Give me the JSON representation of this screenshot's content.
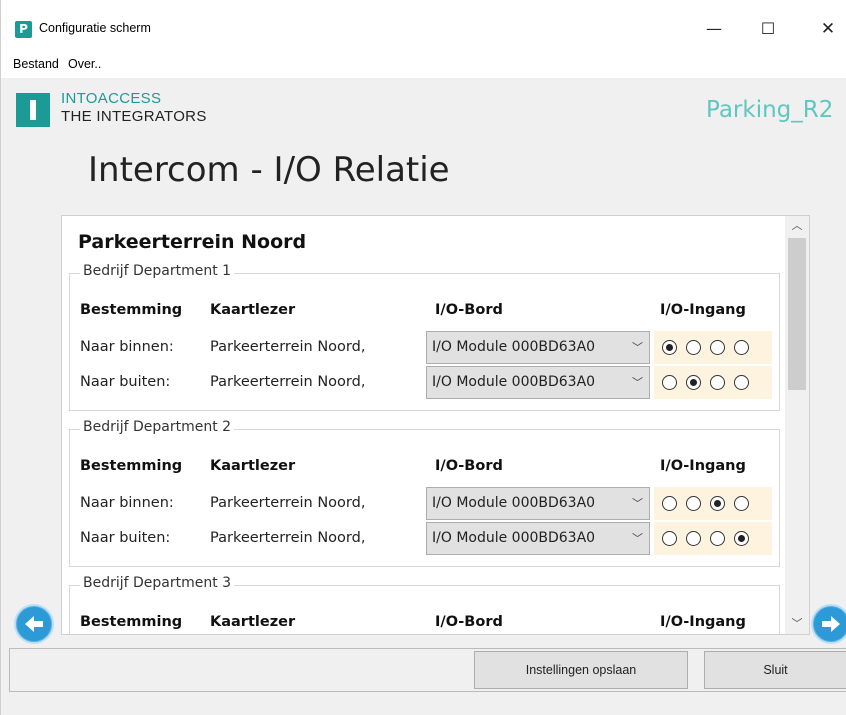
{
  "window": {
    "title": "Configuratie scherm",
    "app_icon_letter": "P",
    "controls": {
      "minimize": "—",
      "maximize": "☐",
      "close": "✕"
    }
  },
  "menu": {
    "items": [
      "Bestand",
      "Over.."
    ]
  },
  "header": {
    "brand_line1": "INTOACCESS",
    "brand_line2": "THE INTEGRATORS",
    "profile": "Parking_R2",
    "brand_color": "#1c9a95"
  },
  "page_title": "Intercom - I/O Relatie",
  "lot": {
    "name": "Parkeerterrein Noord",
    "column_headers": {
      "destination": "Bestemming",
      "reader": "Kaartlezer",
      "io_board": "I/O-Bord",
      "io_input": "I/O-Ingang"
    },
    "departments": [
      {
        "name": "Bedrijf Department 1",
        "rows": [
          {
            "destination": "Naar binnen:",
            "reader": "Parkeerterrein Noord,",
            "io_board": "I/O Module 000BD63A0",
            "selected_input": 0
          },
          {
            "destination": "Naar buiten:",
            "reader": "Parkeerterrein Noord,",
            "io_board": "I/O Module 000BD63A0",
            "selected_input": 1
          }
        ]
      },
      {
        "name": "Bedrijf Department 2",
        "rows": [
          {
            "destination": "Naar binnen:",
            "reader": "Parkeerterrein Noord,",
            "io_board": "I/O Module 000BD63A0",
            "selected_input": 2
          },
          {
            "destination": "Naar buiten:",
            "reader": "Parkeerterrein Noord,",
            "io_board": "I/O Module 000BD63A0",
            "selected_input": 3
          }
        ]
      },
      {
        "name": "Bedrijf Department 3",
        "rows": []
      }
    ]
  },
  "navigation": {
    "prev_icon": "arrow-left-icon",
    "next_icon": "arrow-right-icon"
  },
  "buttons": {
    "save": "Instellingen opslaan",
    "close": "Sluit"
  },
  "colors": {
    "radio_bg": "#fdf3df",
    "nav_blue": "#2b9ad6",
    "profile_color": "#5fc7c1"
  }
}
